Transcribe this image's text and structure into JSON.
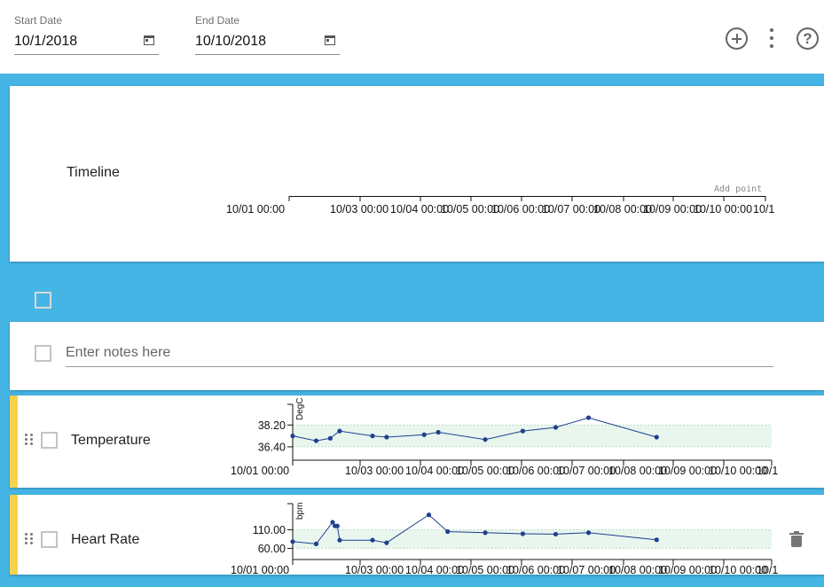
{
  "header": {
    "start_date": {
      "label": "Start Date",
      "value": "10/1/2018"
    },
    "end_date": {
      "label": "End Date",
      "value": "10/10/2018"
    },
    "icons": {
      "add": "add-circle-icon",
      "more": "more-vert-icon",
      "help": "help-circle-icon",
      "calendar": "calendar-icon"
    }
  },
  "timeline": {
    "title": "Timeline",
    "add_point_label": "Add point",
    "ticks": [
      "10/01 00:00",
      "10/03 00:00",
      "10/04 00:00",
      "10/05 00:00",
      "10/06 00:00",
      "10/07 00:00",
      "10/08 00:00",
      "10/09 00:00",
      "10/10 00:00",
      "10/1"
    ]
  },
  "notes": {
    "placeholder": "Enter notes here"
  },
  "colors": {
    "background": "#45b5e6",
    "accent": "#f5d24c",
    "line": "#1f3f8f",
    "band": "#e8f6ee"
  },
  "chart_data": [
    {
      "type": "line",
      "title": "Temperature",
      "ylabel": "DegC",
      "y_ticks": [
        38.2,
        36.4
      ],
      "y_tick_labels": [
        "38.20",
        "36.40"
      ],
      "normal_range": [
        36.4,
        38.2
      ],
      "ylim": [
        35.3,
        39.9
      ],
      "x_tick_labels": [
        "10/01 00:00",
        "10/03 00:00",
        "10/04 00:00",
        "10/05 00:00",
        "10/06 00:00",
        "10/07 00:00",
        "10/08 00:00",
        "10/09 00:00",
        "10/10 00:00",
        "10/1"
      ],
      "xlim_days": [
        0,
        10.2
      ],
      "x_days": [
        0.0,
        0.5,
        0.8,
        1.0,
        1.7,
        2.0,
        2.8,
        3.1,
        4.1,
        4.9,
        5.6,
        6.3,
        7.75
      ],
      "values": [
        37.3,
        36.9,
        37.1,
        37.7,
        37.3,
        37.2,
        37.4,
        37.6,
        37.0,
        37.7,
        38.0,
        38.8,
        37.2
      ]
    },
    {
      "type": "line",
      "title": "Heart Rate",
      "ylabel": "bpm",
      "y_ticks": [
        110.0,
        60.0
      ],
      "y_tick_labels": [
        "110.00",
        "60.00"
      ],
      "normal_range": [
        60.0,
        110.0
      ],
      "ylim": [
        30,
        180
      ],
      "x_tick_labels": [
        "10/01 00:00",
        "10/03 00:00",
        "10/04 00:00",
        "10/05 00:00",
        "10/06 00:00",
        "10/07 00:00",
        "10/08 00:00",
        "10/09 00:00",
        "10/10 00:00",
        "10/1"
      ],
      "xlim_days": [
        0,
        10.2
      ],
      "x_days": [
        0.0,
        0.5,
        0.85,
        0.9,
        0.95,
        1.0,
        1.7,
        2.0,
        2.9,
        3.3,
        4.1,
        4.9,
        5.6,
        6.3,
        7.75
      ],
      "values": [
        78,
        72,
        130,
        120,
        120,
        82,
        82,
        75,
        150,
        105,
        102,
        99,
        98,
        102,
        83
      ]
    }
  ]
}
